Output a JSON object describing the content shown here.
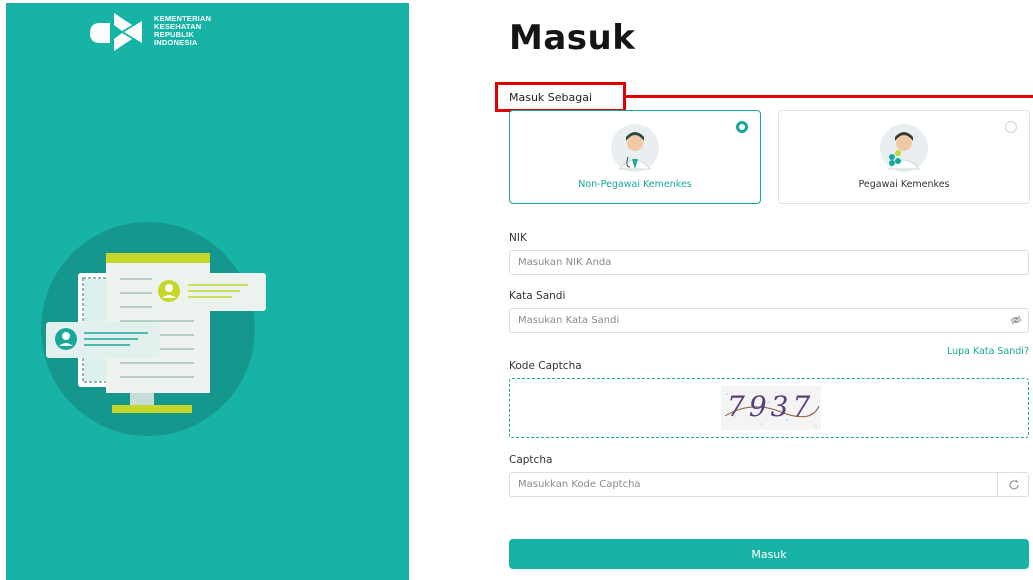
{
  "brand": {
    "logo_lines": [
      "KEMENTERIAN",
      "KESEHATAN",
      "REPUBLIK",
      "INDONESIA"
    ]
  },
  "form": {
    "title": "Masuk",
    "role_section_label": "Masuk Sebagai",
    "roles": [
      {
        "label": "Non-Pegawai Kemenkes",
        "selected": true
      },
      {
        "label": "Pegawai Kemenkes",
        "selected": false
      }
    ],
    "nik": {
      "label": "NIK",
      "placeholder": "Masukan NIK Anda"
    },
    "password": {
      "label": "Kata Sandi",
      "placeholder": "Masukan Kata Sandi"
    },
    "forgot_password": "Lupa Kata Sandi?",
    "captcha_code": {
      "label": "Kode Captcha",
      "text": "7937"
    },
    "captcha": {
      "label": "Captcha",
      "placeholder": "Masukkan Kode Captcha"
    },
    "submit_label": "Masuk"
  },
  "colors": {
    "brand": "#17b3a6",
    "accent": "#17a89c",
    "highlight": "#e10000"
  },
  "icons": [
    "kemenkes-logo-icon",
    "eye-off-icon",
    "refresh-icon",
    "doctor-avatar-icon",
    "employee-avatar-icon"
  ]
}
